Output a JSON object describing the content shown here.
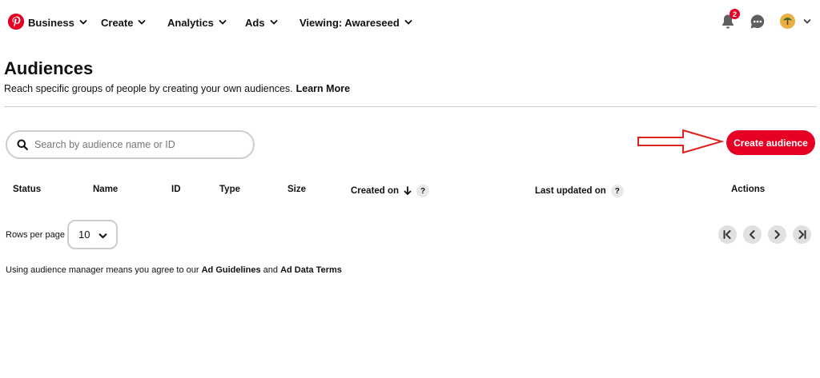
{
  "topnav": {
    "items": [
      {
        "label": "Business"
      },
      {
        "label": "Create"
      },
      {
        "label": "Analytics"
      },
      {
        "label": "Ads"
      },
      {
        "label": "Viewing: Awareseed"
      }
    ],
    "notifications_count": "2",
    "icons": [
      "pinterest-logo",
      "bell-icon",
      "messages-icon",
      "avatar",
      "chevron-down-icon"
    ],
    "brand_color": "#e60023"
  },
  "header": {
    "title": "Audiences",
    "subtitle": "Reach specific groups of people by creating your own audiences.",
    "learn_more": "Learn More"
  },
  "search": {
    "placeholder": "Search by audience name or ID"
  },
  "create_button": {
    "label": "Create audience"
  },
  "table": {
    "columns": [
      "Status",
      "Name",
      "ID",
      "Type",
      "Size",
      "Created on",
      "Last updated on",
      "Actions"
    ],
    "help_glyph": "?"
  },
  "pagination": {
    "rows_per_page_label": "Rows per page",
    "rows_per_page_value": "10"
  },
  "footer": {
    "prefix": "Using audience manager means you agree to our",
    "link1": "Ad Guidelines",
    "and": "and",
    "link2": "Ad Data Terms"
  }
}
